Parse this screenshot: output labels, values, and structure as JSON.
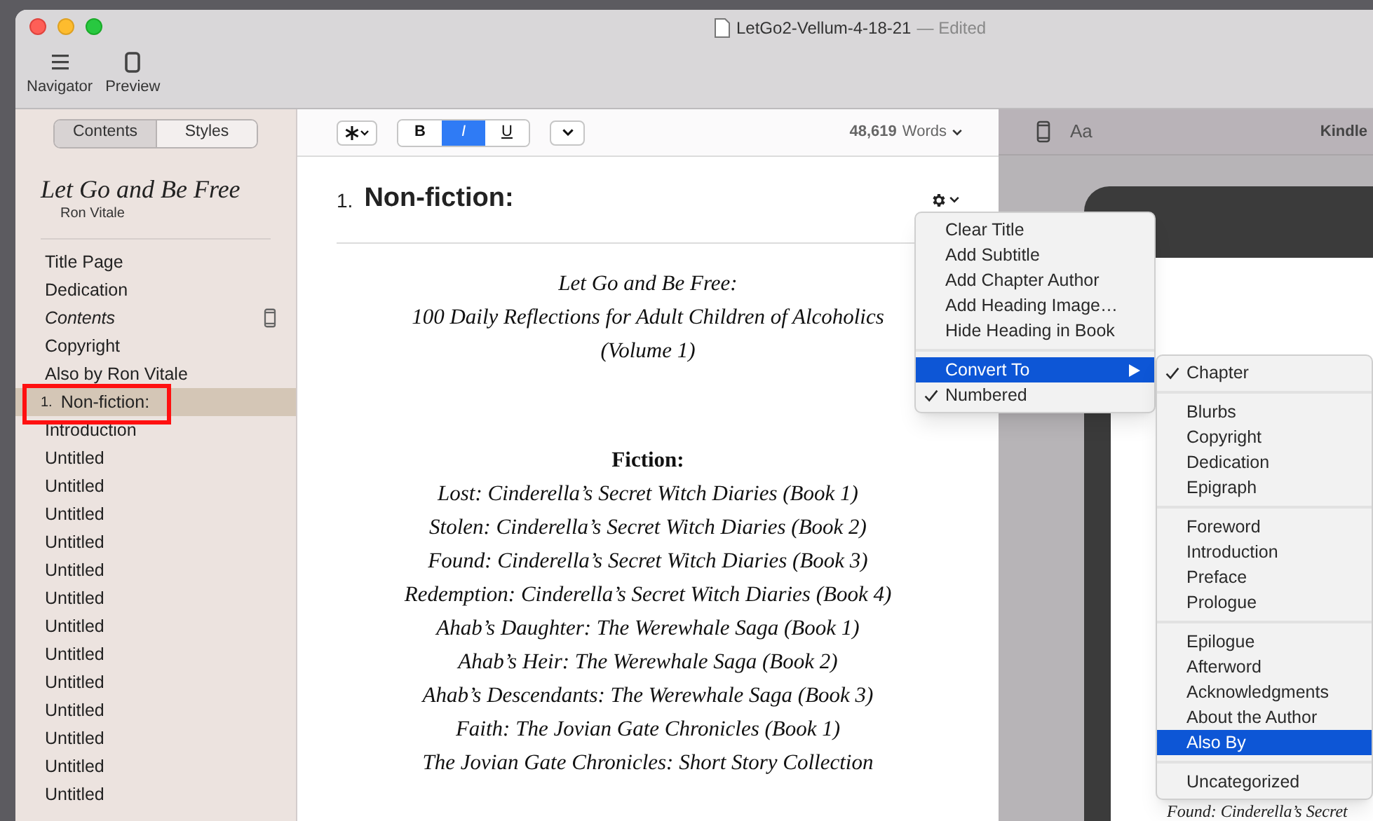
{
  "window": {
    "title": "LetGo2-Vellum-4-18-21",
    "status": "— Edited"
  },
  "toolbar": {
    "items": [
      {
        "kind": "navigator",
        "label": "Navigator"
      },
      {
        "kind": "preview",
        "label": "Preview"
      }
    ]
  },
  "sidebar": {
    "tabs": [
      {
        "label": "Contents",
        "selected": true
      },
      {
        "label": "Styles",
        "selected": false
      }
    ],
    "book_title": "Let Go and Be Free",
    "author": "Ron Vitale",
    "items": [
      {
        "label": "Title Page",
        "selected": false,
        "kind": "plain"
      },
      {
        "label": "Dedication",
        "selected": false,
        "kind": "plain"
      },
      {
        "label": "Contents",
        "selected": false,
        "kind": "contents"
      },
      {
        "label": "Copyright",
        "selected": false,
        "kind": "plain"
      },
      {
        "label": "Also by Ron Vitale",
        "selected": false,
        "kind": "plain"
      },
      {
        "number": "1.",
        "label": "Non-fiction:",
        "selected": true,
        "kind": "numbered"
      },
      {
        "label": "Introduction",
        "selected": false,
        "kind": "plain"
      },
      {
        "label": "Untitled",
        "selected": false,
        "kind": "plain"
      },
      {
        "label": "Untitled",
        "selected": false,
        "kind": "plain"
      },
      {
        "label": "Untitled",
        "selected": false,
        "kind": "plain"
      },
      {
        "label": "Untitled",
        "selected": false,
        "kind": "plain"
      },
      {
        "label": "Untitled",
        "selected": false,
        "kind": "plain"
      },
      {
        "label": "Untitled",
        "selected": false,
        "kind": "plain"
      },
      {
        "label": "Untitled",
        "selected": false,
        "kind": "plain"
      },
      {
        "label": "Untitled",
        "selected": false,
        "kind": "plain"
      },
      {
        "label": "Untitled",
        "selected": false,
        "kind": "plain"
      },
      {
        "label": "Untitled",
        "selected": false,
        "kind": "plain"
      },
      {
        "label": "Untitled",
        "selected": false,
        "kind": "plain"
      },
      {
        "label": "Untitled",
        "selected": false,
        "kind": "plain"
      },
      {
        "label": "Untitled",
        "selected": false,
        "kind": "plain"
      }
    ]
  },
  "editor": {
    "format_buttons": [
      {
        "label": "B",
        "on": false,
        "kind": "bold"
      },
      {
        "label": "I",
        "on": true,
        "kind": "italic"
      },
      {
        "label": "U",
        "on": false,
        "kind": "underline"
      }
    ],
    "word_count": {
      "number": "48,619",
      "label": "Words"
    },
    "heading": {
      "number": "1.",
      "title": "Non-fiction:"
    },
    "title_lines": [
      "Let Go and Be Free:",
      "100 Daily Reflections for Adult Children of Alcoholics",
      "(Volume 1)"
    ],
    "section_heading": "Fiction:",
    "book_lines": [
      "Lost: Cinderella’s Secret Witch Diaries (Book 1)",
      "Stolen: Cinderella’s Secret Witch Diaries (Book 2)",
      "Found: Cinderella’s Secret Witch Diaries (Book 3)",
      "Redemption: Cinderella’s Secret Witch Diaries (Book 4)",
      "Ahab’s Daughter: The Werewhale Saga (Book 1)",
      "Ahab’s Heir: The Werewhale Saga (Book 2)",
      "Ahab’s Descendants: The Werewhale Saga (Book 3)",
      "Faith: The Jovian Gate Chronicles (Book 1)",
      "The Jovian Gate Chronicles: Short Story Collection"
    ]
  },
  "context_menu": {
    "groups": [
      [
        {
          "label": "Clear Title",
          "checked": false,
          "selected": false,
          "submenu": false
        },
        {
          "label": "Add Subtitle",
          "checked": false,
          "selected": false,
          "submenu": false
        },
        {
          "label": "Add Chapter Author",
          "checked": false,
          "selected": false,
          "submenu": false
        },
        {
          "label": "Add Heading Image…",
          "checked": false,
          "selected": false,
          "submenu": false
        },
        {
          "label": "Hide Heading in Book",
          "checked": false,
          "selected": false,
          "submenu": false
        }
      ],
      [
        {
          "label": "Convert To",
          "checked": false,
          "selected": true,
          "submenu": true
        },
        {
          "label": "Numbered",
          "checked": true,
          "selected": false,
          "submenu": false
        }
      ]
    ]
  },
  "submenu": {
    "groups": [
      [
        {
          "label": "Chapter",
          "checked": true,
          "selected": false
        }
      ],
      [
        {
          "label": "Blurbs",
          "checked": false,
          "selected": false
        },
        {
          "label": "Copyright",
          "checked": false,
          "selected": false
        },
        {
          "label": "Dedication",
          "checked": false,
          "selected": false
        },
        {
          "label": "Epigraph",
          "checked": false,
          "selected": false
        }
      ],
      [
        {
          "label": "Foreword",
          "checked": false,
          "selected": false
        },
        {
          "label": "Introduction",
          "checked": false,
          "selected": false
        },
        {
          "label": "Preface",
          "checked": false,
          "selected": false
        },
        {
          "label": "Prologue",
          "checked": false,
          "selected": false
        }
      ],
      [
        {
          "label": "Epilogue",
          "checked": false,
          "selected": false
        },
        {
          "label": "Afterword",
          "checked": false,
          "selected": false
        },
        {
          "label": "Acknowledgments",
          "checked": false,
          "selected": false
        },
        {
          "label": "About the Author",
          "checked": false,
          "selected": false
        },
        {
          "label": "Also By",
          "checked": false,
          "selected": true
        }
      ],
      [
        {
          "label": "Uncategorized",
          "checked": false,
          "selected": false
        }
      ]
    ]
  },
  "preview": {
    "font_button": "Aa",
    "device": "Kindle",
    "page_text": "Found: Cinderella’s Secret"
  }
}
